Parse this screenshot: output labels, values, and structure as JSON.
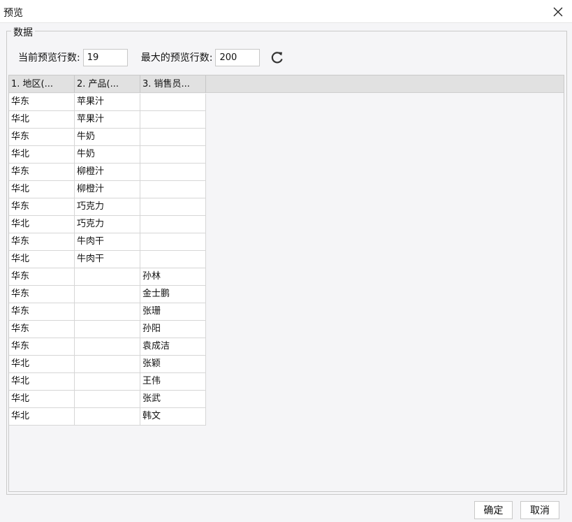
{
  "window": {
    "title": "预览"
  },
  "group": {
    "label": "数据"
  },
  "settings": {
    "current_rows_label": "当前预览行数:",
    "current_rows_value": "19",
    "max_rows_label": "最大的预览行数:",
    "max_rows_value": "200"
  },
  "table": {
    "headers": [
      "1. 地区(...",
      "2. 产品(...",
      "3. 销售员..."
    ],
    "rows": [
      [
        "华东",
        "苹果汁",
        ""
      ],
      [
        "华北",
        "苹果汁",
        ""
      ],
      [
        "华东",
        "牛奶",
        ""
      ],
      [
        "华北",
        "牛奶",
        ""
      ],
      [
        "华东",
        "柳橙汁",
        ""
      ],
      [
        "华北",
        "柳橙汁",
        ""
      ],
      [
        "华东",
        "巧克力",
        ""
      ],
      [
        "华北",
        "巧克力",
        ""
      ],
      [
        "华东",
        "牛肉干",
        ""
      ],
      [
        "华北",
        "牛肉干",
        ""
      ],
      [
        "华东",
        "",
        "孙林"
      ],
      [
        "华东",
        "",
        "金士鹏"
      ],
      [
        "华东",
        "",
        "张珊"
      ],
      [
        "华东",
        "",
        "孙阳"
      ],
      [
        "华东",
        "",
        "袁成洁"
      ],
      [
        "华北",
        "",
        "张颖"
      ],
      [
        "华北",
        "",
        "王伟"
      ],
      [
        "华北",
        "",
        "张武"
      ],
      [
        "华北",
        "",
        "韩文"
      ]
    ]
  },
  "buttons": {
    "ok": "确定",
    "cancel": "取消"
  },
  "icons": {
    "close": "close-icon",
    "refresh": "refresh-icon"
  }
}
